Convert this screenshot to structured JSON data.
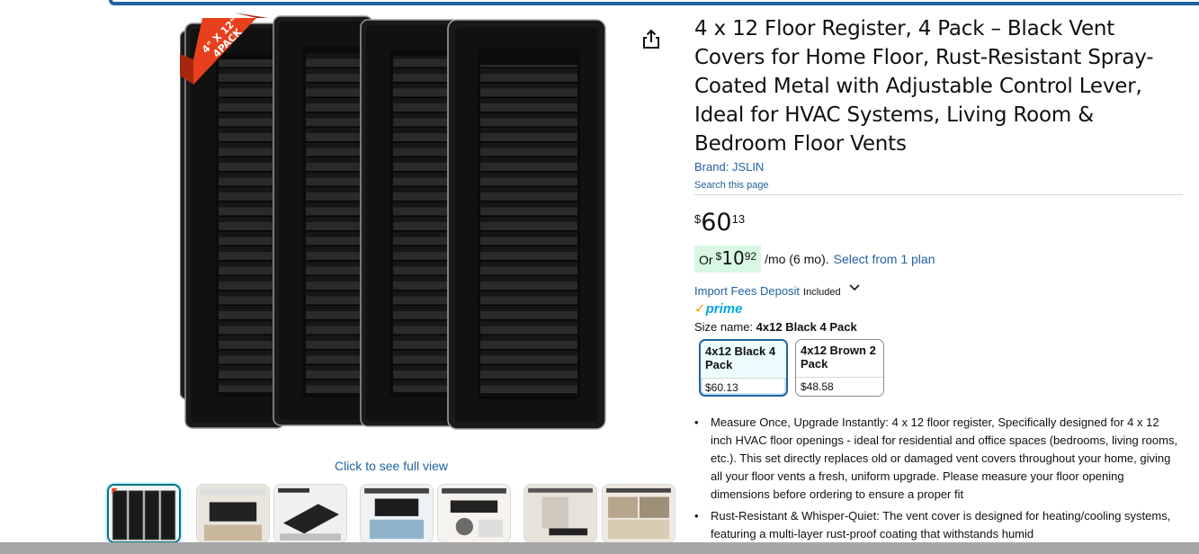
{
  "product": {
    "title": "4 x 12 Floor Register, 4 Pack – Black Vent Covers for Home Floor, Rust-Resistant Spray-Coated Metal with Adjustable Control Lever, Ideal for HVAC Systems, Living Room & Bedroom Floor Vents",
    "brand_link": "Brand: JSLIN",
    "search_page": "Search this page"
  },
  "image": {
    "badge_line1": "4\" X 12\"",
    "badge_line2": "4PACK",
    "click_full_view": "Click to see full view"
  },
  "price": {
    "symbol": "$",
    "whole": "60",
    "fraction": "13"
  },
  "monthly": {
    "or": "Or",
    "symbol": "$",
    "whole": "10",
    "fraction": "92",
    "per": "/mo (6 mo).",
    "plan_link": "Select from 1 plan"
  },
  "fees": {
    "link": "Import Fees Deposit",
    "included": "Included"
  },
  "prime": {
    "check": "✓",
    "word": "prime"
  },
  "size": {
    "label": "Size name:",
    "selected": "4x12 Black 4 Pack",
    "options": [
      {
        "title": "4x12 Black 4 Pack",
        "price": "$60.13"
      },
      {
        "title": "4x12 Brown 2 Pack",
        "price": "$48.58"
      }
    ]
  },
  "bullets": [
    "Measure Once, Upgrade Instantly: 4 x 12 floor register, Specifically designed for 4 x 12 inch HVAC floor openings - ideal for residential and office spaces (bedrooms, living rooms, etc.). This set directly replaces old or damaged vent covers throughout your home, giving all your floor vents a fresh, uniform upgrade. Please measure your floor opening dimensions before ordering to ensure a proper fit",
    "Rust-Resistant & Whisper-Quiet: The vent cover is designed for heating/cooling systems, featuring a multi-layer rust-proof coating that withstands humid"
  ],
  "icons": {
    "share": "share-icon",
    "chevron": "chevron-down-icon"
  },
  "colors": {
    "link": "#2162a1",
    "accent_strip": "#2162a1",
    "badge": "#e8401c",
    "prime_blue": "#00a8e1",
    "prime_check": "#ff9900",
    "monthly_pill": "#d8f8e3"
  }
}
